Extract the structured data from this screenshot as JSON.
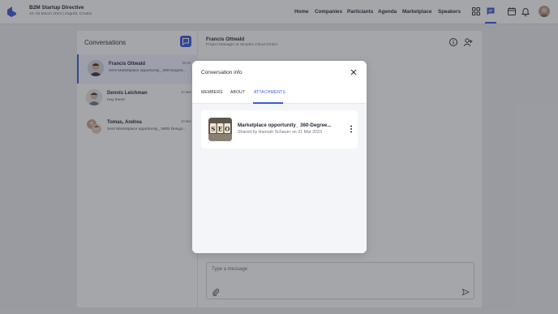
{
  "header": {
    "event_title": "B2M Startup Directive",
    "event_subtitle": "10–25 March 2023 | Zagreb, Croatia",
    "nav": [
      "Home",
      "Companies",
      "Particiants",
      "Agenda",
      "Marketplace",
      "Speakers"
    ],
    "icons": [
      "grid-icon",
      "chat-icon",
      "calendar-icon",
      "bell-icon"
    ],
    "accent_color": "#3b5bdb"
  },
  "conversations": {
    "heading": "Conversations",
    "items": [
      {
        "name": "Francis Ottwald",
        "time": "09:24",
        "preview": "Sent Marketplace opportunity_ 360-Degree..."
      },
      {
        "name": "Dennis Leichman",
        "time": "10 Mar",
        "preview": "Hey there!"
      },
      {
        "name": "Tomas, Andrea",
        "time": "10 Mar",
        "preview": "Sent Marketplace opportunity_ WEB Design..."
      }
    ]
  },
  "chat": {
    "name": "Francis Ottwald",
    "subtitle": "Project Manager at Simplex Cloud GmbH",
    "composer_placeholder": "Type a message"
  },
  "modal": {
    "title": "Conversation info",
    "tabs": [
      "MEMBERS",
      "ABOUT",
      "ATTACHMENTS"
    ],
    "active_tab": "ATTACHMENTS",
    "attachment": {
      "thumb_text": "SEO",
      "name": "Marketplace opportunity_ 360-Degree...",
      "meta": "Shared by Hannah Schauer on 21 Mar 2023"
    }
  }
}
